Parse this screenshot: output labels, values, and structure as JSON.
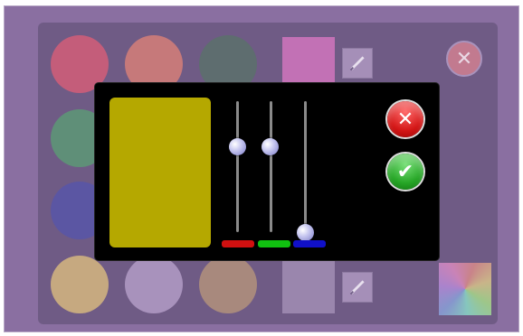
{
  "colors": {
    "frame": "#8a6fa1",
    "panel": "#6f5b85",
    "dialog_bg": "#000000",
    "preview_color": "#b5a800"
  },
  "palette_circles": [
    {
      "color": "#c45d7a",
      "name": "red-swatch"
    },
    {
      "color": "#c6797a",
      "name": "salmon-swatch"
    },
    {
      "color": "#5e6d6f",
      "name": "dark-teal-swatch"
    },
    {
      "color": "#5f8f78",
      "name": "green-swatch"
    },
    {
      "color": "#5b56a3",
      "name": "blue-swatch"
    },
    {
      "color": "#c6a980",
      "name": "sand-swatch"
    },
    {
      "color": "#a892bc",
      "name": "lavender-swatch"
    },
    {
      "color": "#a8897d",
      "name": "taupe-swatch"
    }
  ],
  "square_swatches": [
    {
      "color": "#c271b5",
      "name": "magenta-square-swatch"
    },
    {
      "color": "#9a86ad",
      "name": "gray-square-swatch"
    }
  ],
  "icons": {
    "close_outer": "close-icon",
    "edit_top": "pencil-icon",
    "edit_bottom": "pencil-icon",
    "cancel": "close-icon",
    "confirm": "checkmark-icon"
  },
  "sliders": {
    "red": {
      "level": 0.65,
      "channel_color": "#d01010"
    },
    "green": {
      "level": 0.65,
      "channel_color": "#10c010"
    },
    "blue": {
      "level": 0.0,
      "channel_color": "#1010c8"
    }
  }
}
